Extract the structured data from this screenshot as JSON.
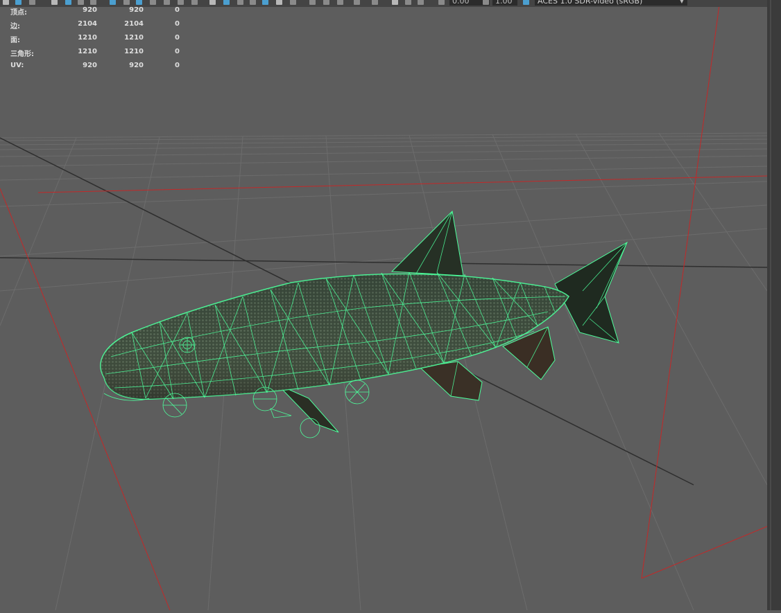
{
  "toolbar": {
    "exposure_value": "0.00",
    "gamma_value": "1.00",
    "color_space": "ACES 1.0 SDR-video (sRGB)"
  },
  "hud": {
    "rows": [
      {
        "label": "顶点:",
        "v1": "920",
        "v2": "920",
        "v3": "0"
      },
      {
        "label": "边:",
        "v1": "2104",
        "v2": "2104",
        "v3": "0"
      },
      {
        "label": "面:",
        "v1": "1210",
        "v2": "1210",
        "v3": "0"
      },
      {
        "label": "三角形:",
        "v1": "1210",
        "v2": "1210",
        "v3": "0"
      },
      {
        "label": "UV:",
        "v1": "920",
        "v2": "920",
        "v3": "0"
      }
    ]
  },
  "colors": {
    "viewport_bg": "#5d5d5d",
    "grid_line": "#6c6c6c",
    "grid_axis": "#2a2a2a",
    "camera_frustum": "#c42828",
    "wireframe": "#4dff9c",
    "fish_body": "#2d3a2f"
  },
  "icons": [
    "select-tool-icon",
    "lasso-icon",
    "paint-select-icon",
    "grid-icon",
    "shaded-cube-icon",
    "wireframe-cube-icon",
    "textured-icon",
    "light-icon",
    "shadow-icon",
    "ambient-occlusion-icon",
    "anti-alias-icon",
    "isolate-icon",
    "xray-icon",
    "exposure-icon",
    "gamma-icon",
    "color-management-icon"
  ]
}
